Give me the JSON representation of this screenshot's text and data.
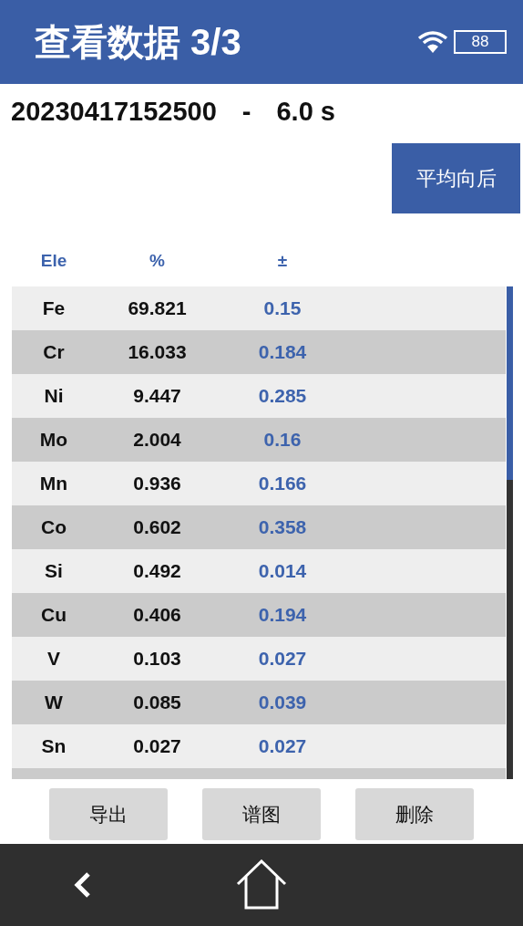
{
  "header": {
    "title": "查看数据 3/3",
    "battery": "88"
  },
  "measurement": {
    "id": "20230417152500",
    "separator": "-",
    "duration": "6.0 s"
  },
  "average_button": "平均向后",
  "table": {
    "columns": [
      "Ele",
      "%",
      "±"
    ],
    "rows": [
      {
        "element": "Fe",
        "percent": "69.821",
        "error": "0.15"
      },
      {
        "element": "Cr",
        "percent": "16.033",
        "error": "0.184"
      },
      {
        "element": "Ni",
        "percent": "9.447",
        "error": "0.285"
      },
      {
        "element": "Mo",
        "percent": "2.004",
        "error": "0.16"
      },
      {
        "element": "Mn",
        "percent": "0.936",
        "error": "0.166"
      },
      {
        "element": "Co",
        "percent": "0.602",
        "error": "0.358"
      },
      {
        "element": "Si",
        "percent": "0.492",
        "error": "0.014"
      },
      {
        "element": "Cu",
        "percent": "0.406",
        "error": "0.194"
      },
      {
        "element": "V",
        "percent": "0.103",
        "error": "0.027"
      },
      {
        "element": "W",
        "percent": "0.085",
        "error": "0.039"
      },
      {
        "element": "Sn",
        "percent": "0.027",
        "error": "0.027"
      }
    ]
  },
  "buttons": [
    "导出",
    "谱图",
    "删除"
  ]
}
